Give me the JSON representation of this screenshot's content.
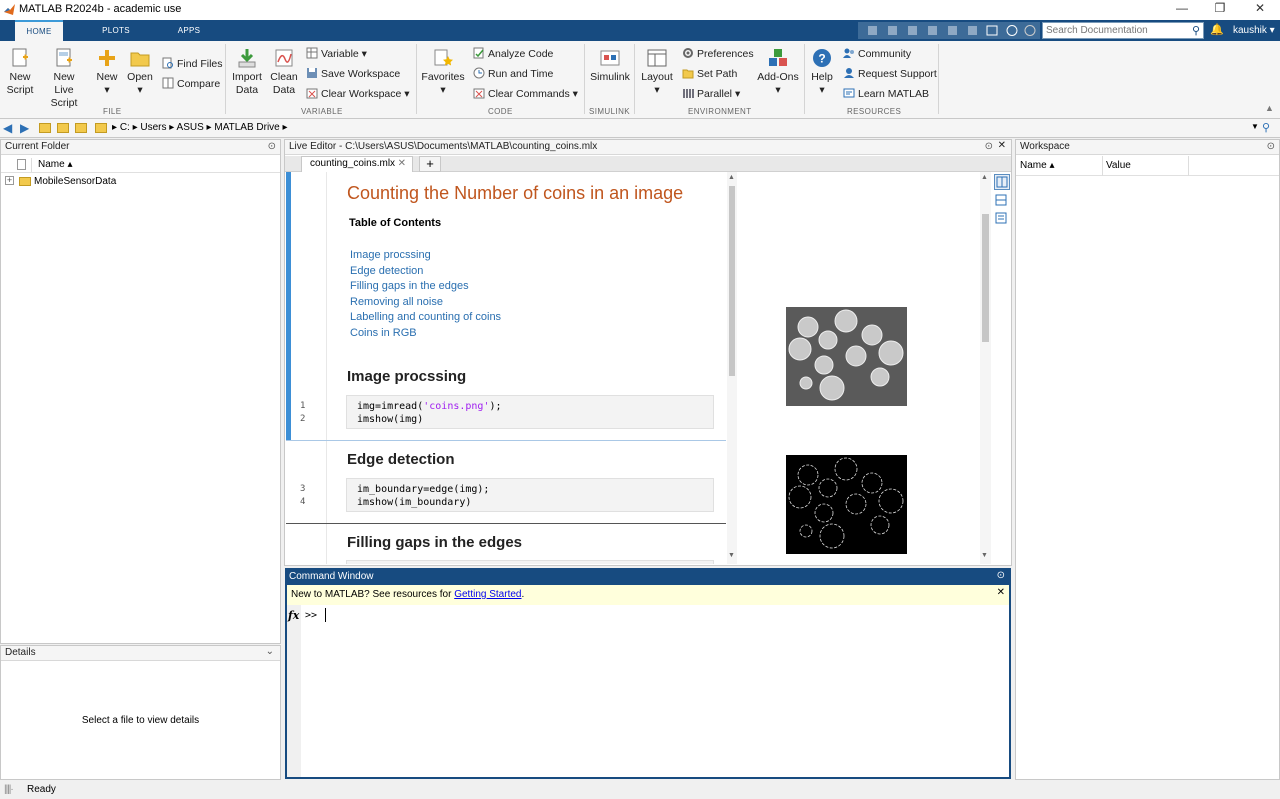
{
  "window": {
    "title": "MATLAB R2024b - academic use",
    "min": "—",
    "max": "❐",
    "close": "✕"
  },
  "tabs": [
    {
      "label": "HOME"
    },
    {
      "label": "PLOTS"
    },
    {
      "label": "APPS"
    }
  ],
  "search": {
    "placeholder": "Search Documentation"
  },
  "user": "kaushik",
  "ribbon": {
    "file": {
      "group": "FILE",
      "new_script": [
        "New",
        "Script"
      ],
      "new_live": [
        "New",
        "Live Script"
      ],
      "new": "New",
      "open": "Open",
      "find_files": "Find Files",
      "compare": "Compare"
    },
    "variable": {
      "group": "VARIABLE",
      "import": [
        "Import",
        "Data"
      ],
      "clean": [
        "Clean",
        "Data"
      ],
      "variable": "Variable",
      "save_ws": "Save Workspace",
      "clear_ws": "Clear Workspace"
    },
    "code": {
      "group": "CODE",
      "favorites": "Favorites",
      "analyze": "Analyze Code",
      "run_time": "Run and Time",
      "clear_cmds": "Clear Commands"
    },
    "simulink": {
      "group": "SIMULINK",
      "simulink": "Simulink"
    },
    "environment": {
      "group": "ENVIRONMENT",
      "layout": "Layout",
      "preferences": "Preferences",
      "set_path": "Set Path",
      "parallel": "Parallel",
      "addons": "Add-Ons"
    },
    "resources": {
      "group": "RESOURCES",
      "help": "Help",
      "community": "Community",
      "request_support": "Request Support",
      "learn": "Learn MATLAB"
    }
  },
  "path": {
    "drive": "C:",
    "parts": [
      "Users",
      "ASUS",
      "MATLAB Drive"
    ]
  },
  "current_folder": {
    "title": "Current Folder",
    "col_name": "Name ▴",
    "items": [
      "MobileSensorData"
    ]
  },
  "details": {
    "title": "Details",
    "empty": "Select a file to view details"
  },
  "editor": {
    "title": "Live Editor - C:\\Users\\ASUS\\Documents\\MATLAB\\counting_coins.mlx",
    "tab": "counting_coins.mlx",
    "doc_title": "Counting the Number of coins in an image",
    "toc_title": "Table of Contents",
    "toc": [
      "Image procssing",
      "Edge detection",
      "Filling gaps in the edges",
      "Removing all noise",
      "Labelling and counting of coins",
      "Coins in RGB"
    ],
    "sections": [
      {
        "title": "Image procssing",
        "lines": [
          {
            "n": "1",
            "pre": "img=imread(",
            "str": "'coins.png'",
            "post": ");"
          },
          {
            "n": "2",
            "pre": "imshow(img)",
            "str": "",
            "post": ""
          }
        ]
      },
      {
        "title": "Edge detection",
        "lines": [
          {
            "n": "3",
            "pre": "im_boundary=edge(img);",
            "str": "",
            "post": ""
          },
          {
            "n": "4",
            "pre": "imshow(im_boundary)",
            "str": "",
            "post": ""
          }
        ]
      },
      {
        "title": "Filling gaps in the edges",
        "lines": []
      }
    ]
  },
  "workspace": {
    "title": "Workspace",
    "col_name": "Name ▴",
    "col_value": "Value"
  },
  "command": {
    "title": "Command Window",
    "banner_text": "New to MATLAB? See resources for ",
    "banner_link": "Getting Started",
    "banner_end": ".",
    "prompt": ">>",
    "fx": "fx"
  },
  "status": "Ready",
  "colors": {
    "ribbon_blue": "#174b80",
    "title_orange": "#c0561e",
    "link_blue": "#2a6fb0",
    "string_purple": "#a020f0"
  }
}
